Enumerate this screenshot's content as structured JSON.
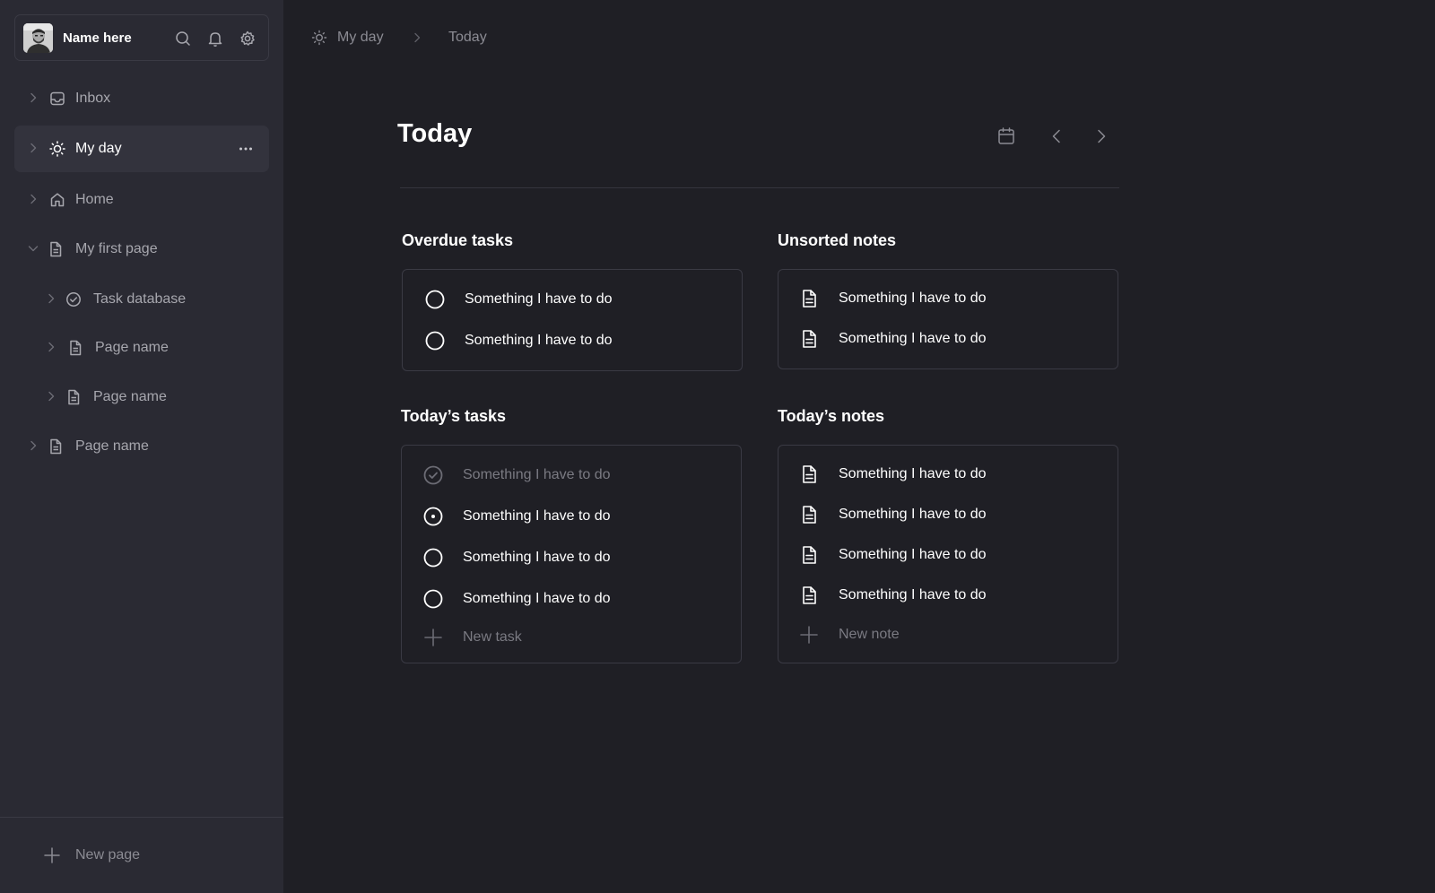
{
  "user": {
    "name": "Name here"
  },
  "sidebar": {
    "items": [
      {
        "label": "Inbox"
      },
      {
        "label": "My day"
      },
      {
        "label": "Home"
      },
      {
        "label": "My first page"
      },
      {
        "label": "Task database"
      },
      {
        "label": "Page name"
      },
      {
        "label": "Page name"
      },
      {
        "label": "Page name"
      }
    ],
    "new_page_label": "New page"
  },
  "breadcrumb": {
    "items": [
      "My day",
      "Today"
    ]
  },
  "header": {
    "title": "Today"
  },
  "sections": {
    "overdue_tasks": {
      "title": "Overdue tasks",
      "items": [
        "Something I have to do",
        "Something I have to do"
      ]
    },
    "unsorted_notes": {
      "title": "Unsorted notes",
      "items": [
        "Something I have to do",
        "Something I have to do"
      ]
    },
    "todays_tasks": {
      "title": "Today’s tasks",
      "items": [
        {
          "text": "Something I have to do",
          "status": "done"
        },
        {
          "text": "Something I have to do",
          "status": "in-progress"
        },
        {
          "text": "Something I have to do",
          "status": "todo"
        },
        {
          "text": "Something I have to do",
          "status": "todo"
        }
      ],
      "add_label": "New task"
    },
    "todays_notes": {
      "title": "Today’s notes",
      "items": [
        "Something I have to do",
        "Something I have to do",
        "Something I have to do",
        "Something I have to do"
      ],
      "add_label": "New note"
    }
  },
  "icons": {
    "header": [
      "calendar-icon",
      "chevron-left-icon",
      "chevron-right-icon"
    ],
    "user_actions": [
      "search-icon",
      "bell-icon",
      "settings-icon"
    ]
  }
}
